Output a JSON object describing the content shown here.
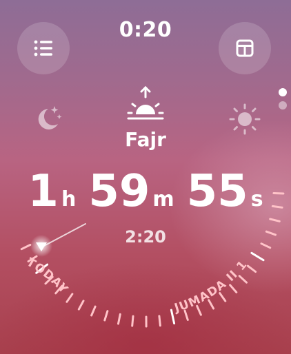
{
  "status": {
    "time": "0:20"
  },
  "toolbar": {
    "list_icon": "list-icon",
    "layout_icon": "layout-icon"
  },
  "pager": {
    "pages": 2,
    "active_index": 0
  },
  "prayer": {
    "previous_icon": "moon-stars-icon",
    "current_icon": "sunrise-icon",
    "next_icon": "sun-icon",
    "name": "Fajr"
  },
  "countdown": {
    "hours": "1",
    "hours_unit": "h",
    "minutes": "59",
    "minutes_unit": "m",
    "seconds": "55",
    "seconds_unit": "s"
  },
  "target_time": "2:20",
  "dial": {
    "today_label": "TODAY",
    "month_label": "JUMADA II 1",
    "accent_color": "#ffffff",
    "tick_color": "#ffc3c8"
  }
}
